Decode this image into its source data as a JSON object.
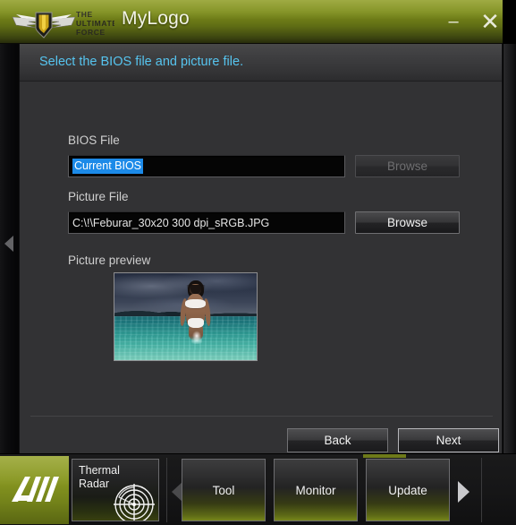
{
  "window": {
    "title": "MyLogo",
    "brand_line1": "THE",
    "brand_line2": "ULTIMATE",
    "brand_line3": "FORCE",
    "minimize_label": "–",
    "close_label": "✕",
    "accent_olive": "#8d9b1f",
    "accent_cyan": "#56c4ef"
  },
  "subheader": {
    "text": "Select the BIOS file and picture file."
  },
  "form": {
    "bios": {
      "label": "BIOS File",
      "value": "Current BIOS",
      "placeholder": "",
      "browse_label": "Browse",
      "browse_enabled": false
    },
    "picture": {
      "label": "Picture File",
      "value": "C:\\!\\Feburar_30x20 300 dpi_sRGB.JPG",
      "placeholder": "",
      "browse_label": "Browse",
      "browse_enabled": true
    },
    "preview": {
      "label": "Picture preview",
      "alt": "beach-photo-woman-in-sea"
    }
  },
  "nav": {
    "back_label": "Back",
    "next_label": "Next"
  },
  "rails": {
    "left_icon": "triangle-left-icon",
    "right_icon": "panel-edge"
  },
  "dock": {
    "suite_logo": "ai-suite-logo",
    "thermal": {
      "line1": "Thermal",
      "line2": "Radar",
      "icon": "radar-icon"
    },
    "arrow_left": "triangle-left-icon",
    "arrow_right": "triangle-right-icon",
    "buttons": [
      {
        "label": "Tool"
      },
      {
        "label": "Monitor"
      },
      {
        "label": "Update"
      }
    ]
  }
}
